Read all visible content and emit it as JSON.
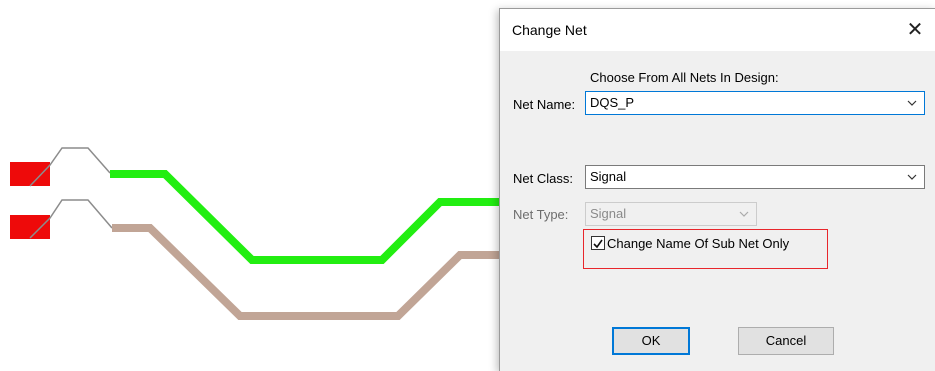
{
  "dialog": {
    "title": "Change Net",
    "close_label": "✕",
    "choose_label": "Choose From All Nets In Design:",
    "net_name": {
      "label": "Net Name:",
      "value": "DQS_P"
    },
    "net_class": {
      "label": "Net Class:",
      "value": "Signal"
    },
    "net_type": {
      "label": "Net Type:",
      "value": "Signal",
      "disabled": true
    },
    "change_subnet": {
      "label": "Change Name Of Sub Net  Only",
      "checked": true
    },
    "ok_label": "OK",
    "cancel_label": "Cancel"
  },
  "canvas": {
    "trace_colors": {
      "green": "#22ee11",
      "tan": "#c1a596",
      "pad": "#ee0a0a",
      "thin": "#8c8c8c"
    }
  }
}
